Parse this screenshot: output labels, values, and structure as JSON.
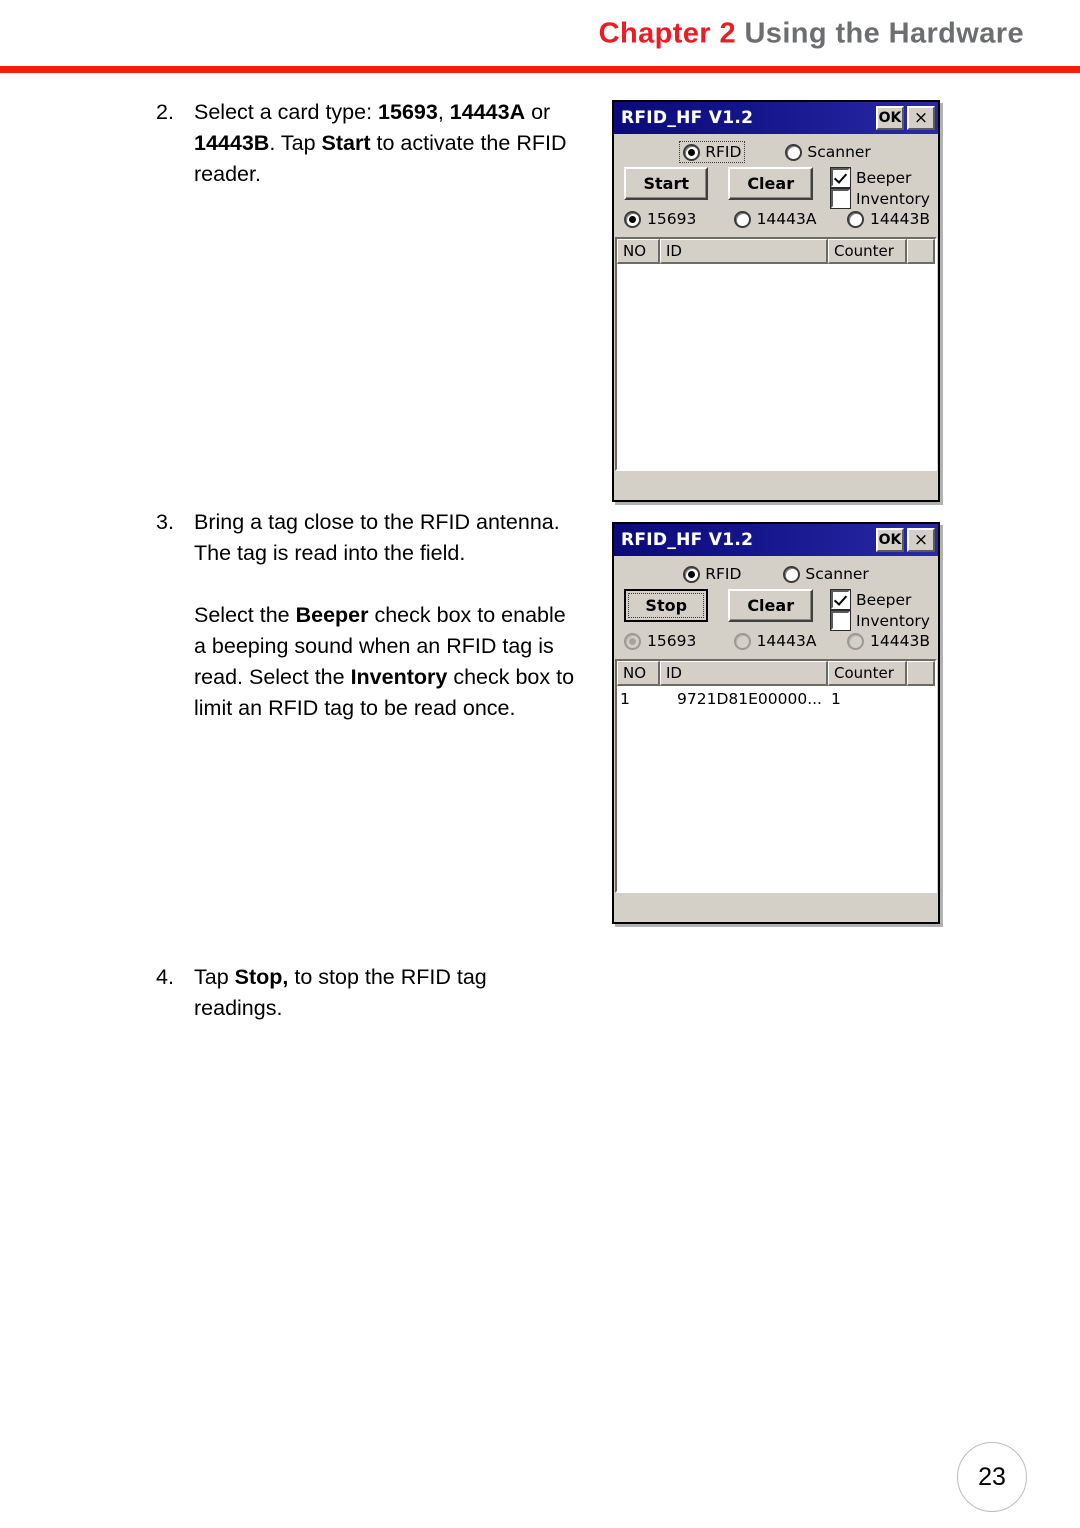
{
  "header": {
    "chapter_label": "Chapter 2",
    "section_title": "Using the Hardware"
  },
  "steps": [
    {
      "number": "2.",
      "paragraphs": [
        [
          {
            "t": "Select a card type: ",
            "b": false
          },
          {
            "t": "15693",
            "b": true
          },
          {
            "t": ", ",
            "b": false
          },
          {
            "t": "14443A",
            "b": true
          },
          {
            "t": " or ",
            "b": false
          },
          {
            "t": "14443B",
            "b": true
          },
          {
            "t": ". Tap ",
            "b": false
          },
          {
            "t": "Start",
            "b": true
          },
          {
            "t": " to activate the RFID reader.",
            "b": false
          }
        ]
      ]
    },
    {
      "number": "3.",
      "paragraphs": [
        [
          {
            "t": " Bring a tag close to the RFID antenna. The tag is read into the field.",
            "b": false
          }
        ],
        [
          {
            "t": "Select the ",
            "b": false
          },
          {
            "t": "Beeper",
            "b": true
          },
          {
            "t": " check box to enable a beeping sound when an RFID tag is read. Select the ",
            "b": false
          },
          {
            "t": "Inventory",
            "b": true
          },
          {
            "t": " check box to limit an RFID tag to be read once.",
            "b": false
          }
        ]
      ]
    },
    {
      "number": "4.",
      "paragraphs": [
        [
          {
            "t": "Tap ",
            "b": false
          },
          {
            "t": "Stop,",
            "b": true
          },
          {
            "t": " to stop the RFID tag readings.",
            "b": false
          }
        ]
      ]
    }
  ],
  "dialogs": [
    {
      "title": "RFID_HF V1.2",
      "ok_label": "OK",
      "close_label": "×",
      "mode_options": [
        {
          "label": "RFID",
          "selected": true,
          "focused": true
        },
        {
          "label": "Scanner",
          "selected": false,
          "focused": false
        }
      ],
      "action_button": {
        "label": "Start",
        "focused": false
      },
      "clear_button": {
        "label": "Clear"
      },
      "checkboxes": [
        {
          "label": "Beeper",
          "checked": true
        },
        {
          "label": "Inventory",
          "checked": false
        }
      ],
      "card_types": [
        {
          "label": "15693",
          "selected": true,
          "disabled": false
        },
        {
          "label": "14443A",
          "selected": false,
          "disabled": false
        },
        {
          "label": "14443B",
          "selected": false,
          "disabled": false
        }
      ],
      "table": {
        "columns": [
          "NO",
          "ID",
          "Counter",
          ""
        ],
        "rows": []
      }
    },
    {
      "title": "RFID_HF V1.2",
      "ok_label": "OK",
      "close_label": "×",
      "mode_options": [
        {
          "label": "RFID",
          "selected": true,
          "focused": false
        },
        {
          "label": "Scanner",
          "selected": false,
          "focused": false
        }
      ],
      "action_button": {
        "label": "Stop",
        "focused": true
      },
      "clear_button": {
        "label": "Clear"
      },
      "checkboxes": [
        {
          "label": "Beeper",
          "checked": true
        },
        {
          "label": "Inventory",
          "checked": false
        }
      ],
      "card_types": [
        {
          "label": "15693",
          "selected": true,
          "disabled": true
        },
        {
          "label": "14443A",
          "selected": false,
          "disabled": true
        },
        {
          "label": "14443B",
          "selected": false,
          "disabled": true
        }
      ],
      "table": {
        "columns": [
          "NO",
          "ID",
          "Counter",
          ""
        ],
        "rows": [
          {
            "no": "1",
            "id": "9721D81E00000...",
            "counter": "1"
          }
        ]
      }
    }
  ],
  "page_number": "23",
  "colors": {
    "accent_red": "#ed1c24",
    "rule_red": "#f91b0d",
    "section_gray": "#6d6e71",
    "titlebar_blue": "#191991",
    "dialog_face": "#d4d0c8"
  }
}
